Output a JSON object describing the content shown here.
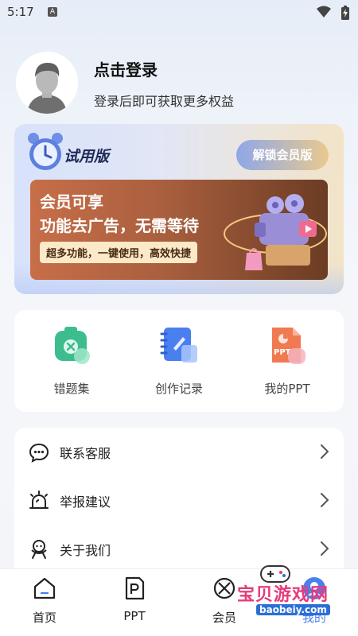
{
  "status_bar": {
    "time": "5:17",
    "notification_glyph": "A"
  },
  "profile": {
    "title": "点击登录",
    "subtitle": "登录后即可获取更多权益"
  },
  "vip_card": {
    "badge": "试用版",
    "unlock_button": "解锁会员版",
    "line1": "会员可享",
    "line2": "功能去广告，无需等待",
    "tagline": "超多功能，一键使用，高效快捷"
  },
  "tools": [
    {
      "label": "错题集",
      "icon": "wrong-questions-icon",
      "color": "#3dbd8e"
    },
    {
      "label": "创作记录",
      "icon": "creation-record-icon",
      "color": "#4a7ff0"
    },
    {
      "label": "我的PPT",
      "icon": "ppt-icon",
      "color": "#f07a52"
    }
  ],
  "menu": [
    {
      "label": "联系客服",
      "icon": "chat-icon"
    },
    {
      "label": "举报建议",
      "icon": "alarm-icon"
    },
    {
      "label": "关于我们",
      "icon": "about-icon"
    }
  ],
  "nav": [
    {
      "label": "首页",
      "icon": "home-icon"
    },
    {
      "label": "PPT",
      "icon": "ppt-nav-icon"
    },
    {
      "label": "会员",
      "icon": "vip-nav-icon"
    },
    {
      "label": "我的",
      "icon": "profile-nav-icon",
      "active": true
    }
  ],
  "watermark": {
    "text": "宝贝游戏网",
    "url": "baobeiy.com"
  },
  "colors": {
    "accent_blue": "#4a7ff0",
    "vip_brown": "#a95f3e",
    "gold": "#e9c98f"
  }
}
